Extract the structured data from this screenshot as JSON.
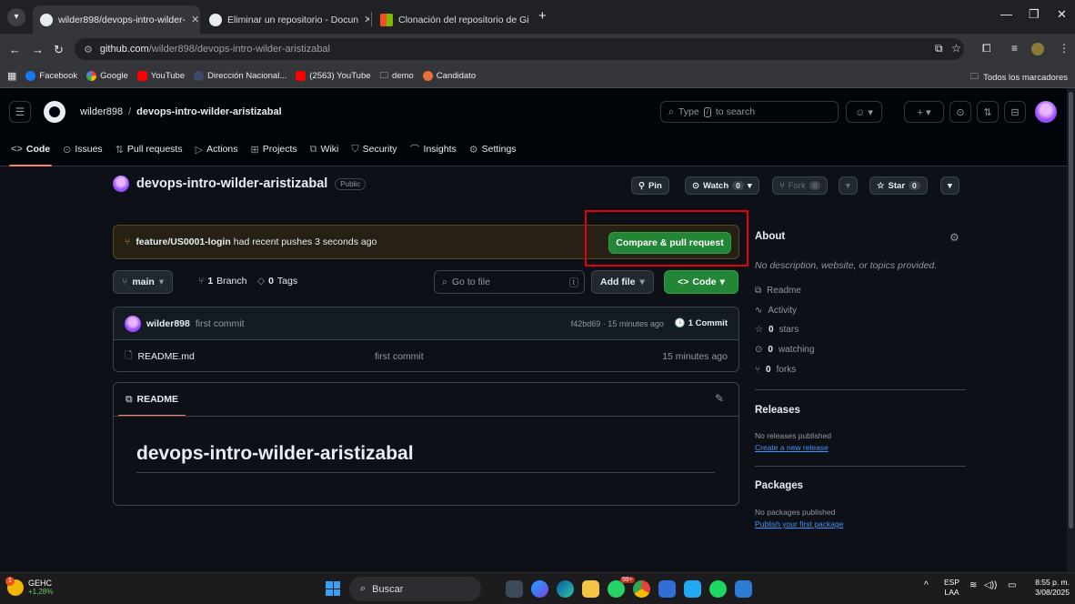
{
  "browser": {
    "tabs": [
      {
        "label": "wilder898/devops-intro-wilder-",
        "active": true
      },
      {
        "label": "Eliminar un repositorio - Docun",
        "active": false
      },
      {
        "label": "Clonación del repositorio de Gi",
        "active": false
      }
    ],
    "url_host": "github.com",
    "url_path": "/wilder898/devops-intro-wilder-aristizabal",
    "bookmarks": [
      "Facebook",
      "Google",
      "YouTube",
      "Dirección Nacional...",
      "(2563) YouTube",
      "demo",
      "Candidato"
    ],
    "all_bookmarks": "Todos los marcadores"
  },
  "header": {
    "owner": "wilder898",
    "repo": "devops-intro-wilder-aristizabal",
    "search_prefix": "Type",
    "search_key": "/",
    "search_suffix": "to search"
  },
  "repo_nav": {
    "code": "Code",
    "issues": "Issues",
    "pull_requests": "Pull requests",
    "actions": "Actions",
    "projects": "Projects",
    "wiki": "Wiki",
    "security": "Security",
    "insights": "Insights",
    "settings": "Settings"
  },
  "repo": {
    "name": "devops-intro-wilder-aristizabal",
    "visibility": "Public",
    "pin": "Pin",
    "watch": "Watch",
    "watch_count": "0",
    "fork": "Fork",
    "fork_count": "0",
    "star": "Star",
    "star_count": "0"
  },
  "banner": {
    "branch": "feature/US0001-login",
    "text": "had recent pushes 3 seconds ago",
    "button": "Compare & pull request"
  },
  "file_bar": {
    "branch": "main",
    "branch_count": "1",
    "branch_label": "Branch",
    "tag_count": "0",
    "tag_label": "Tags",
    "go_to_file": "Go to file",
    "go_key": "t",
    "add_file": "Add file",
    "code": "Code"
  },
  "commit": {
    "user": "wilder898",
    "message": "first commit",
    "meta": "f42bd69 · 15 minutes ago",
    "count": "1 Commit"
  },
  "files": [
    {
      "name": "README.md",
      "message": "first commit",
      "time": "15 minutes ago"
    }
  ],
  "readme": {
    "tab": "README",
    "heading": "devops-intro-wilder-aristizabal"
  },
  "about": {
    "title": "About",
    "description": "No description, website, or topics provided.",
    "readme": "Readme",
    "activity": "Activity",
    "stars_count": "0",
    "stars_label": "stars",
    "watching_count": "0",
    "watching_label": "watching",
    "forks_count": "0",
    "forks_label": "forks"
  },
  "releases": {
    "title": "Releases",
    "none": "No releases published",
    "link": "Create a new release"
  },
  "packages": {
    "title": "Packages",
    "none": "No packages published",
    "link": "Publish your first package"
  },
  "taskbar": {
    "weather_notif": "1",
    "weather_name": "GEHC",
    "weather_change": "+1,28%",
    "search": "Buscar",
    "whatsapp_badge": "99+",
    "lang_top": "ESP",
    "lang_bottom": "LAA",
    "time": "8:55 p. m.",
    "date": "3/08/2025"
  }
}
